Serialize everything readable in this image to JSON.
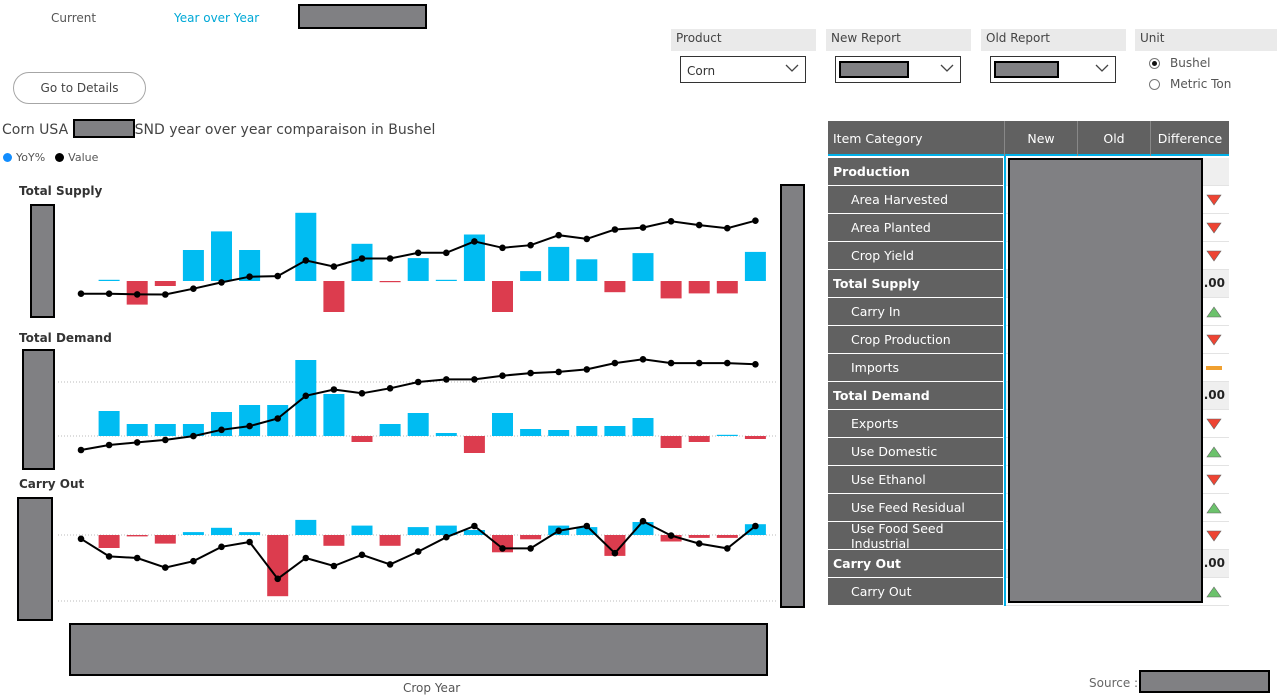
{
  "nav": {
    "tab_current": "Current",
    "tab_yoy": "Year over Year"
  },
  "buttons": {
    "details": "Go to Details"
  },
  "slicers": {
    "product": {
      "header": "Product",
      "value": "Corn"
    },
    "new_report": {
      "header": "New Report",
      "value": ""
    },
    "old_report": {
      "header": "Old Report",
      "value": ""
    },
    "unit": {
      "header": "Unit",
      "options": [
        "Bushel",
        "Metric Ton"
      ],
      "selected": "Bushel"
    }
  },
  "chart": {
    "title_a": "Corn USA",
    "title_b": "SND year over year comparaison in Bushel",
    "legend_yoy": "YoY%",
    "legend_value": "Value",
    "xlabel": "Crop Year",
    "colors": {
      "positive": "#00bcf2",
      "negative": "#dc3c4e",
      "line": "#000000",
      "yoy_legend": "#118dff"
    },
    "panel_titles": [
      "Total Supply",
      "Total Demand",
      "Carry Out"
    ]
  },
  "chart_data": [
    {
      "type": "bar+line",
      "title": "Total Supply",
      "series": [
        {
          "name": "YoY%",
          "values": [
            0,
            0.1,
            -3.8,
            -0.8,
            5,
            8,
            5,
            0,
            11,
            -5,
            6,
            -0.1,
            3.7,
            0.1,
            7.5,
            -5,
            1.6,
            5.5,
            3.5,
            -1.8,
            4.5,
            -2.8,
            -2,
            -2,
            4.7
          ]
        },
        {
          "name": "Value",
          "values": [
            0.2,
            0.2,
            0.1,
            0.08,
            1,
            2,
            2.9,
            3,
            5.5,
            4.5,
            5.8,
            5.8,
            6.7,
            6.7,
            8.5,
            7.5,
            7.9,
            9.5,
            8.9,
            10.4,
            10.7,
            11.7,
            11.1,
            10.6,
            11.8
          ]
        }
      ]
    },
    {
      "type": "bar+line",
      "title": "Total Demand",
      "series": [
        {
          "name": "YoY%",
          "values": [
            0,
            2.5,
            1.2,
            1.2,
            1.2,
            2.4,
            3.1,
            3.1,
            7.6,
            4.2,
            -0.6,
            1.2,
            2.3,
            0.3,
            -1.7,
            2.3,
            0.7,
            0.6,
            1,
            1,
            1.8,
            -1.2,
            -0.6,
            0.1,
            -0.3
          ]
        },
        {
          "name": "Value",
          "values": [
            0,
            0.4,
            0.6,
            0.8,
            1.1,
            1.6,
            1.9,
            2.5,
            4.3,
            4.8,
            4.5,
            4.9,
            5.4,
            5.6,
            5.6,
            5.9,
            6.1,
            6.2,
            6.4,
            6.9,
            7.2,
            6.9,
            6.9,
            6.9,
            6.8
          ]
        }
      ]
    },
    {
      "type": "bar+line",
      "title": "Carry Out",
      "series": [
        {
          "name": "YoY%",
          "values": [
            0,
            -1.8,
            -0.2,
            -1.2,
            0.4,
            1,
            0.4,
            -8.5,
            2.1,
            -1.5,
            1.3,
            -1.5,
            1.1,
            1.3,
            0.7,
            -2.4,
            -0.6,
            1.3,
            1.1,
            -2.9,
            1.8,
            -0.9,
            -0.4,
            -0.4,
            1.5
          ]
        },
        {
          "name": "Value",
          "values": [
            0.2,
            -0.9,
            -1,
            -1.6,
            -1.2,
            -0.3,
            0,
            -2.3,
            -1,
            -1.5,
            -0.8,
            -1.4,
            -0.6,
            0.3,
            1,
            -0.4,
            -0.4,
            0.7,
            1,
            -0.7,
            1.3,
            0.4,
            -0.1,
            -0.4,
            1
          ]
        }
      ]
    }
  ],
  "table": {
    "headers": [
      "Item Category",
      "New",
      "Old",
      "Difference"
    ],
    "rows": [
      {
        "label": "Production",
        "kind": "group",
        "diff": "",
        "indicator": ""
      },
      {
        "label": "Area Harvested",
        "kind": "sub",
        "diff": "",
        "indicator": "down"
      },
      {
        "label": "Area Planted",
        "kind": "sub",
        "diff": "",
        "indicator": "down"
      },
      {
        "label": "Crop Yield",
        "kind": "sub",
        "diff": "",
        "indicator": "down"
      },
      {
        "label": "Total Supply",
        "kind": "group",
        "diff": ".00",
        "indicator": ""
      },
      {
        "label": "Carry In",
        "kind": "sub",
        "diff": "",
        "indicator": "up"
      },
      {
        "label": "Crop Production",
        "kind": "sub",
        "diff": "",
        "indicator": "down"
      },
      {
        "label": "Imports",
        "kind": "sub",
        "diff": "",
        "indicator": "flat"
      },
      {
        "label": "Total Demand",
        "kind": "group",
        "diff": ".00",
        "indicator": ""
      },
      {
        "label": "Exports",
        "kind": "sub",
        "diff": "",
        "indicator": "down"
      },
      {
        "label": "Use Domestic",
        "kind": "sub",
        "diff": "",
        "indicator": "up"
      },
      {
        "label": "Use Ethanol",
        "kind": "sub",
        "diff": "",
        "indicator": "down"
      },
      {
        "label": "Use Feed Residual",
        "kind": "sub",
        "diff": "",
        "indicator": "up"
      },
      {
        "label": "Use Food Seed Industrial",
        "kind": "sub",
        "diff": "",
        "indicator": "down"
      },
      {
        "label": "Carry Out",
        "kind": "group",
        "diff": ".00",
        "indicator": ""
      },
      {
        "label": "Carry Out",
        "kind": "sub",
        "diff": "",
        "indicator": "up"
      }
    ],
    "indicator_colors": {
      "up": "#6cc26c",
      "down": "#ee4433",
      "flat": "#f0a030"
    }
  },
  "footer": {
    "source_label": "Source :"
  }
}
